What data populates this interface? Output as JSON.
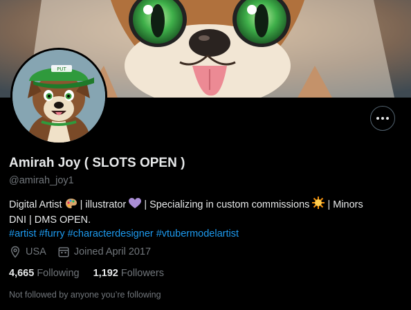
{
  "profile": {
    "display_name": "Amirah Joy ( SLOTS OPEN )",
    "handle": "@amirah_joy1",
    "bio_line1_a": "Digital Artist",
    "bio_line1_b": "| illustrator",
    "bio_line1_c": "| Specializing in custom commissions",
    "bio_line1_d": "| Minors",
    "bio_line2": "DNI | DMS OPEN.",
    "hashtags": [
      "#artist",
      "#furry",
      "#characterdesigner",
      "#vtubermodelartist"
    ],
    "location": "USA",
    "joined": "Joined April 2017",
    "following_count": "4,665",
    "following_label": "Following",
    "followers_count": "1,192",
    "followers_label": "Followers",
    "follow_note": "Not followed by anyone you’re following"
  },
  "icons": {
    "more": "more-horizontal-icon",
    "location": "location-pin-icon",
    "calendar": "calendar-icon",
    "emoji_palette": "palette-emoji",
    "emoji_heart": "purple-heart-emoji",
    "emoji_sun": "sun-emoji"
  },
  "colors": {
    "background": "#000000",
    "text": "#e7e9ea",
    "secondary": "#71767b",
    "link": "#1d9bf0",
    "border": "#536471"
  }
}
